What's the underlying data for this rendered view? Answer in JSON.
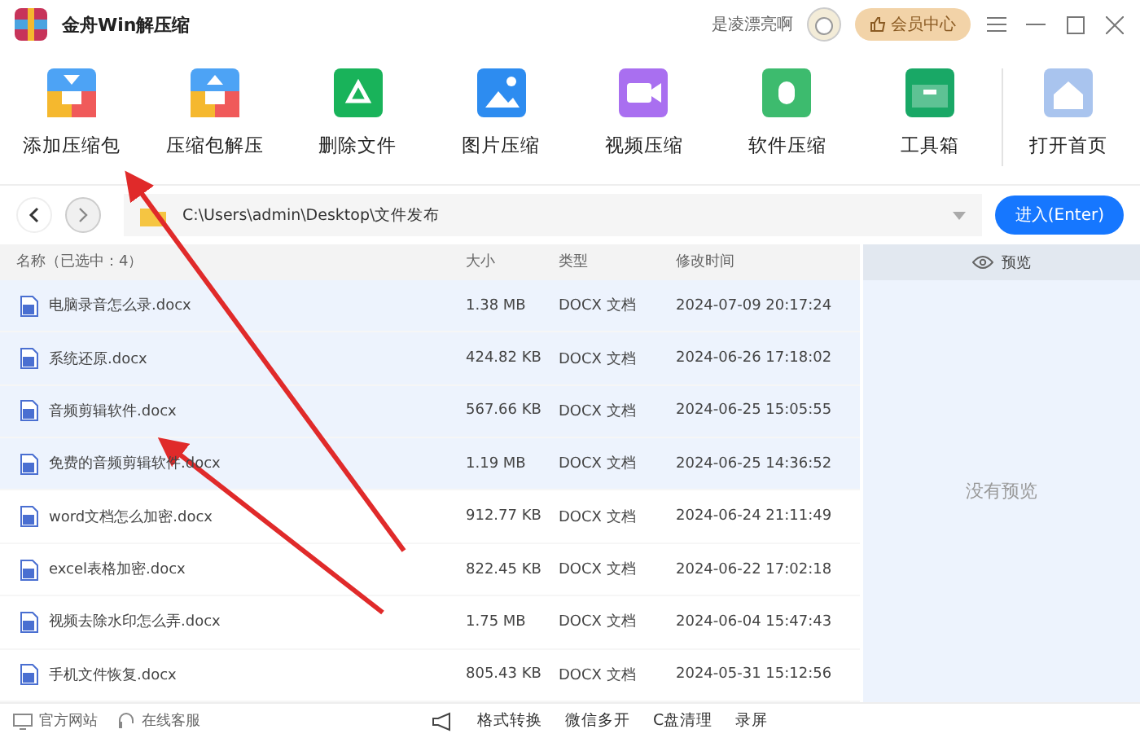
{
  "window": {
    "title": "金舟Win解压缩",
    "user": "是凌漂亮啊",
    "vip_button": "会员中心"
  },
  "toolbar": [
    {
      "label": "添加压缩包"
    },
    {
      "label": "压缩包解压"
    },
    {
      "label": "删除文件"
    },
    {
      "label": "图片压缩"
    },
    {
      "label": "视频压缩"
    },
    {
      "label": "软件压缩"
    },
    {
      "label": "工具箱"
    },
    {
      "label": "打开首页"
    }
  ],
  "address": {
    "path": "C:\\Users\\admin\\Desktop\\文件发布",
    "enter_button": "进入(Enter)"
  },
  "table": {
    "columns": [
      "名称（已选中：4）",
      "大小",
      "类型",
      "修改时间"
    ],
    "rows": [
      {
        "name": "电脑录音怎么录.docx",
        "size": "1.38 MB",
        "type": "DOCX 文档",
        "modified": "2024-07-09 20:17:24",
        "selected": true
      },
      {
        "name": "系统还原.docx",
        "size": "424.82 KB",
        "type": "DOCX 文档",
        "modified": "2024-06-26 17:18:02",
        "selected": true
      },
      {
        "name": "音频剪辑软件.docx",
        "size": "567.66 KB",
        "type": "DOCX 文档",
        "modified": "2024-06-25 15:05:55",
        "selected": true
      },
      {
        "name": "免费的音频剪辑软件.docx",
        "size": "1.19 MB",
        "type": "DOCX 文档",
        "modified": "2024-06-25 14:36:52",
        "selected": true
      },
      {
        "name": "word文档怎么加密.docx",
        "size": "912.77 KB",
        "type": "DOCX 文档",
        "modified": "2024-06-24 21:11:49",
        "selected": false
      },
      {
        "name": "excel表格加密.docx",
        "size": "822.45 KB",
        "type": "DOCX 文档",
        "modified": "2024-06-22 17:02:18",
        "selected": false
      },
      {
        "name": "视频去除水印怎么弄.docx",
        "size": "1.75 MB",
        "type": "DOCX 文档",
        "modified": "2024-06-04 15:47:43",
        "selected": false
      },
      {
        "name": "手机文件恢复.docx",
        "size": "805.43 KB",
        "type": "DOCX 文档",
        "modified": "2024-05-31 15:12:56",
        "selected": false
      }
    ]
  },
  "preview": {
    "title": "预览",
    "empty_text": "没有预览"
  },
  "status_bar": {
    "left": [
      "官方网站",
      "在线客服"
    ],
    "tools": [
      "格式转换",
      "微信多开",
      "C盘清理",
      "录屏"
    ]
  }
}
